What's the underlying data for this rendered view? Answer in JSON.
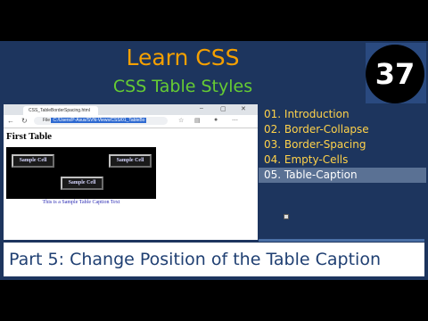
{
  "header": {
    "title": "Learn CSS",
    "subtitle": "CSS Table Styles",
    "episode_number": "37"
  },
  "browser": {
    "tab_title": "CSS_TableBorderSpacing.html",
    "address_label": "File",
    "address_url": "C:/Users/P-Asus/SVN-Views/CSS/01_TableBo",
    "page_heading": "First Table",
    "cells": [
      "Sample Cell",
      "Sample Cell",
      "Sample Cell"
    ],
    "caption": "This is a Sample Table Caption Text"
  },
  "toc": {
    "items": [
      {
        "label": "01. Introduction"
      },
      {
        "label": "02. Border-Collapse"
      },
      {
        "label": "03. Border-Spacing"
      },
      {
        "label": "04. Empty-Cells"
      },
      {
        "label": "05. Table-Caption"
      }
    ],
    "active_index": 4
  },
  "footer": {
    "text": "Part 5: Change Position of the Table Caption"
  },
  "colors": {
    "title": "#f5a000",
    "subtitle": "#66cc33",
    "toc_text": "#ffd24a",
    "background": "#1d355e"
  }
}
